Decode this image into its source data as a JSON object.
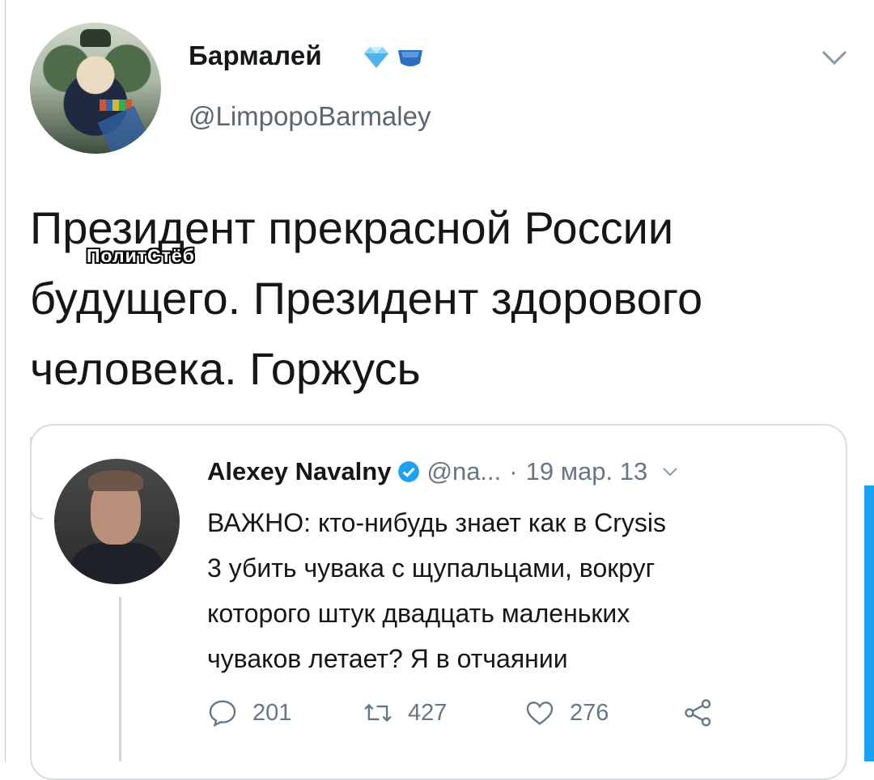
{
  "tweet": {
    "author_name": "Бармалей",
    "author_handle": "@LimpopoBarmaley",
    "badge_icons": [
      "diamond-icon",
      "blue-crown-icon"
    ],
    "text": "Президент прекрасной России\nбудущего. Президент здорового\nчеловека. Горжусь",
    "watermark": "ПолитСтёб"
  },
  "quoted": {
    "author_name": "Alexey Navalny",
    "handle_truncated": "@na...",
    "separator": "·",
    "date": "19 мар. 13",
    "text": "ВАЖНО: кто-нибудь знает как в Crysis\n3 убить чувака с щупальцами, вокруг\nкоторого штук двадцать маленьких\nчуваков летает? Я в отчаянии",
    "actions": {
      "reply_count": "201",
      "retweet_count": "427",
      "like_count": "276"
    }
  },
  "colors": {
    "text": "#14171a",
    "muted": "#657786",
    "verified": "#1da1f2",
    "border": "#d7dde2"
  }
}
